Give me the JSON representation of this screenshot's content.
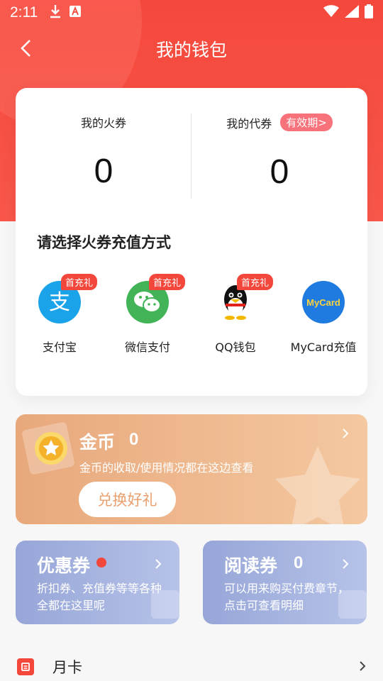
{
  "status_bar": {
    "time": "2:11"
  },
  "header": {
    "title": "我的钱包"
  },
  "balances": {
    "huoquan": {
      "label": "我的火券",
      "value": "0"
    },
    "daiquan": {
      "label": "我的代券",
      "value": "0",
      "badge": "有效期>"
    }
  },
  "recharge": {
    "title": "请选择火券充值方式",
    "methods": [
      {
        "label": "支付宝",
        "badge": "首充礼",
        "icon": "alipay-icon",
        "color": "#1aa3e8"
      },
      {
        "label": "微信支付",
        "badge": "首充礼",
        "icon": "wechat-pay-icon",
        "color": "#42b457"
      },
      {
        "label": "QQ钱包",
        "badge": "首充礼",
        "icon": "qq-wallet-icon",
        "color": "#111111"
      },
      {
        "label": "MyCard充值",
        "badge": "",
        "icon": "mycard-icon",
        "color": "#1f7be0"
      }
    ]
  },
  "gold": {
    "title": "金币",
    "count": "0",
    "desc": "金币的收取/使用情况都在这边查看",
    "button": "兑换好礼"
  },
  "coupons": {
    "title": "优惠券",
    "desc": "折扣券、充值券等等各种全都在这里呢"
  },
  "reading": {
    "title": "阅读券",
    "count": "0",
    "desc": "可以用来购买付费章节，点击可查看明细"
  },
  "list": {
    "month_card": "月卡"
  },
  "colors": {
    "primary": "#f5483c",
    "gold": "#e8a87c",
    "coupon": "#97a6d8"
  }
}
